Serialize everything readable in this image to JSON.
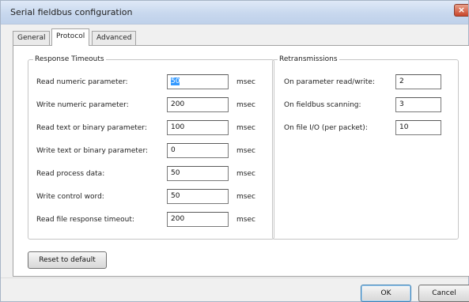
{
  "window": {
    "title": "Serial fieldbus configuration",
    "close_glyph": "×"
  },
  "tabs": [
    {
      "label": "General",
      "active": false
    },
    {
      "label": "Protocol",
      "active": true
    },
    {
      "label": "Advanced",
      "active": false
    }
  ],
  "response_timeouts": {
    "title": "Response Timeouts",
    "rows": [
      {
        "label": "Read numeric parameter:",
        "value": "50",
        "unit": "msec",
        "selected": true
      },
      {
        "label": "Write numeric parameter:",
        "value": "200",
        "unit": "msec"
      },
      {
        "label": "Read text or binary parameter:",
        "value": "100",
        "unit": "msec"
      },
      {
        "label": "Write text or binary parameter:",
        "value": "0",
        "unit": "msec"
      },
      {
        "label": "Read process data:",
        "value": "50",
        "unit": "msec"
      },
      {
        "label": "Write control word:",
        "value": "50",
        "unit": "msec"
      },
      {
        "label": "Read file response timeout:",
        "value": "200",
        "unit": "msec"
      }
    ]
  },
  "retransmissions": {
    "title": "Retransmissions",
    "rows": [
      {
        "label": "On parameter read/write:",
        "value": "2"
      },
      {
        "label": "On fieldbus scanning:",
        "value": "3"
      },
      {
        "label": "On file I/O (per packet):",
        "value": "10"
      }
    ]
  },
  "buttons": {
    "reset": "Reset to default",
    "ok": "OK",
    "cancel": "Cancel"
  },
  "colors": {
    "selection": "#3399ff",
    "titlebar": "#c8d8ee",
    "close": "#c9452b"
  },
  "icons": {
    "close": "close-icon"
  }
}
